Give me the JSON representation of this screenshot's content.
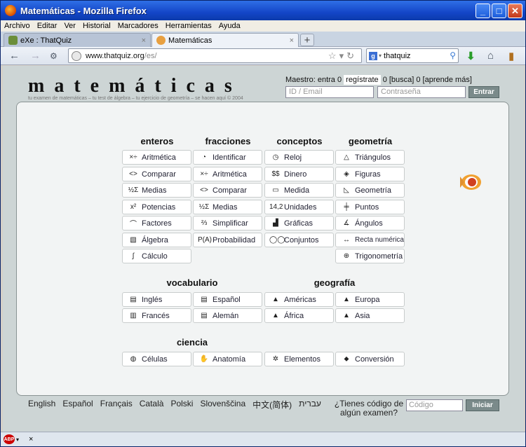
{
  "window": {
    "title": "Matemáticas - Mozilla Firefox",
    "min": "_",
    "max": "□",
    "close": "✕"
  },
  "menu": [
    "Archivo",
    "Editar",
    "Ver",
    "Historial",
    "Marcadores",
    "Herramientas",
    "Ayuda"
  ],
  "tabs": [
    {
      "label": "eXe : ThatQuiz"
    },
    {
      "label": "Matemáticas"
    }
  ],
  "tab_close": "×",
  "new_tab": "+",
  "nav": {
    "back": "←",
    "forward": "→",
    "home": "⌂"
  },
  "url": {
    "host": "www.thatquiz.org",
    "path": "/es/"
  },
  "search": {
    "engine": "g",
    "value": "thatquiz"
  },
  "site": {
    "logo": "matemáticas",
    "tagline": "tu examen de matemáticas – tu test de álgebra – tu ejercicio de geometría – se hacen aquí © 2004",
    "maestro": "Maestro: entra 0",
    "registrate": "regístrate",
    "busca": "0 [busca] 0 [aprende más]",
    "email_placeholder": "ID / Email",
    "password_placeholder": "Contraseña",
    "entrar": "Entrar"
  },
  "sections": {
    "enteros": {
      "title": "enteros",
      "items": [
        {
          "icon": "×÷",
          "label": "Aritmética"
        },
        {
          "icon": "<>",
          "label": "Comparar"
        },
        {
          "icon": "½Σ",
          "label": "Medias"
        },
        {
          "icon": "x²",
          "label": "Potencias"
        },
        {
          "icon": "⌒",
          "label": "Factores"
        },
        {
          "icon": "▧",
          "label": "Álgebra"
        },
        {
          "icon": "∫",
          "label": "Cálculo"
        }
      ]
    },
    "fracciones": {
      "title": "fracciones",
      "items": [
        {
          "icon": "◔",
          "label": "Identificar"
        },
        {
          "icon": "×÷",
          "label": "Aritmética"
        },
        {
          "icon": "<>",
          "label": "Comparar"
        },
        {
          "icon": "½Σ",
          "label": "Medias"
        },
        {
          "icon": "⅔",
          "label": "Simplificar"
        },
        {
          "icon": "P(A)",
          "label": "Probabilidad"
        }
      ]
    },
    "conceptos": {
      "title": "conceptos",
      "items": [
        {
          "icon": "◷",
          "label": "Reloj"
        },
        {
          "icon": "$$",
          "label": "Dinero"
        },
        {
          "icon": "▭",
          "label": "Medida"
        },
        {
          "icon": "14,2",
          "label": "Unidades"
        },
        {
          "icon": "▟",
          "label": "Gráficas"
        },
        {
          "icon": "◯◯",
          "label": "Conjuntos"
        }
      ]
    },
    "geometria": {
      "title": "geometría",
      "items": [
        {
          "icon": "△",
          "label": "Triángulos"
        },
        {
          "icon": "◈",
          "label": "Figuras"
        },
        {
          "icon": "◺",
          "label": "Geometría"
        },
        {
          "icon": "╪",
          "label": "Puntos"
        },
        {
          "icon": "∡",
          "label": "Ángulos"
        },
        {
          "icon": "↔",
          "label": "Recta numérica"
        },
        {
          "icon": "⊕",
          "label": "Trigonometría"
        }
      ]
    },
    "vocabulario": {
      "title": "vocabulario",
      "items": [
        {
          "icon": "▤",
          "label": "Inglés"
        },
        {
          "icon": "▤",
          "label": "Español"
        },
        {
          "icon": "▥",
          "label": "Francés"
        },
        {
          "icon": "▤",
          "label": "Alemán"
        }
      ]
    },
    "geografia": {
      "title": "geografía",
      "items": [
        {
          "icon": "▲",
          "label": "Américas"
        },
        {
          "icon": "▲",
          "label": "Europa"
        },
        {
          "icon": "▲",
          "label": "África"
        },
        {
          "icon": "▲",
          "label": "Asia"
        }
      ]
    },
    "ciencia": {
      "title": "ciencia",
      "items": [
        {
          "icon": "◍",
          "label": "Células"
        },
        {
          "icon": "✋",
          "label": "Anatomía"
        },
        {
          "icon": "✲",
          "label": "Elementos"
        },
        {
          "icon": "⬥",
          "label": "Conversión"
        }
      ]
    }
  },
  "languages": [
    "English",
    "Español",
    "Français",
    "Català",
    "Polski",
    "Slovenščina",
    "中文(简体)",
    "עברית"
  ],
  "code": {
    "question": "¿Tienes código de algún examen?",
    "placeholder": "Código",
    "button": "Iniciar"
  },
  "status": {
    "abp": "ABP",
    "close": "×"
  }
}
